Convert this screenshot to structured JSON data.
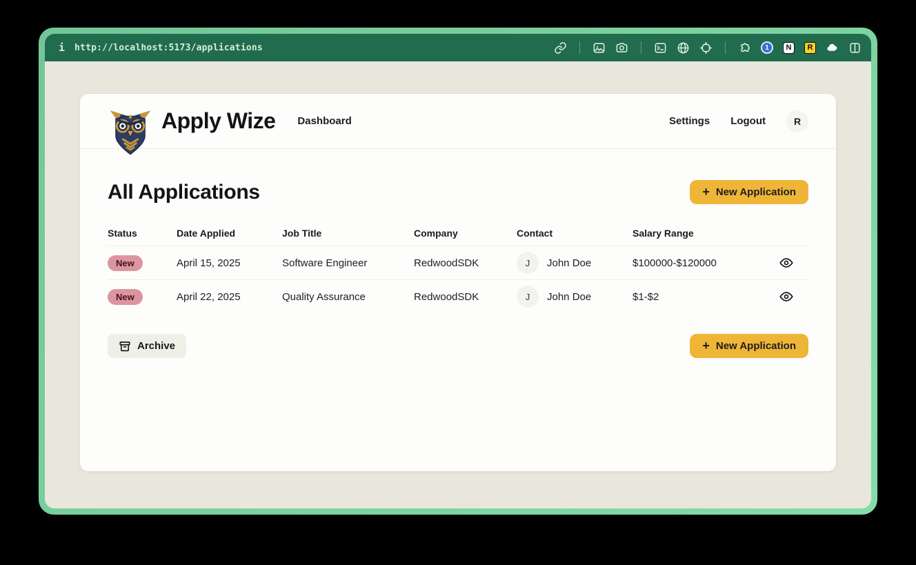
{
  "browser": {
    "info_glyph": "i",
    "url": "http://localhost:5173/applications",
    "toolbar_icons": [
      "link-icon",
      "screenshot-icon",
      "camera-icon",
      "terminal-icon",
      "globe-icon",
      "crosshair-icon",
      "puzzle-icon",
      "onepassword-icon",
      "notion-icon",
      "r-extension-icon",
      "cloud-icon",
      "split-view-icon"
    ],
    "onepassword_glyph": "1",
    "notion_glyph": "N",
    "r_extension_glyph": "R"
  },
  "header": {
    "brand": "Apply Wize",
    "nav": {
      "dashboard": "Dashboard"
    },
    "settings": "Settings",
    "logout": "Logout",
    "avatar_initial": "R"
  },
  "main": {
    "title": "All Applications",
    "new_application_label": "New Application",
    "plus_glyph": "+",
    "archive_label": "Archive",
    "table": {
      "columns": [
        "Status",
        "Date Applied",
        "Job Title",
        "Company",
        "Contact",
        "Salary Range"
      ],
      "rows": [
        {
          "status": "New",
          "date_applied": "April 15, 2025",
          "job_title": "Software Engineer",
          "company": "RedwoodSDK",
          "contact_initial": "J",
          "contact_name": "John Doe",
          "salary_range": "$100000-$120000"
        },
        {
          "status": "New",
          "date_applied": "April 22, 2025",
          "job_title": "Quality Assurance",
          "company": "RedwoodSDK",
          "contact_initial": "J",
          "contact_name": "John Doe",
          "salary_range": "$1-$2"
        }
      ]
    }
  },
  "colors": {
    "accent_yellow": "#efb537",
    "badge_pink": "#dc95a0",
    "frame_green": "#7cd3a2",
    "browser_bar_green": "#216c4f",
    "page_cream": "#e9e7db",
    "logo_navy": "#2c3d63",
    "logo_gold": "#c8963d"
  }
}
